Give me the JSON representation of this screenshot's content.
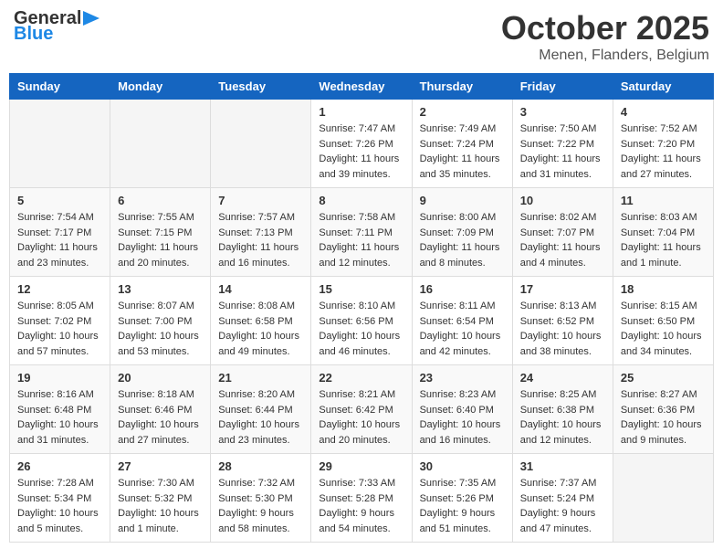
{
  "header": {
    "logo_general": "General",
    "logo_blue": "Blue",
    "month_title": "October 2025",
    "location": "Menen, Flanders, Belgium"
  },
  "days_of_week": [
    "Sunday",
    "Monday",
    "Tuesday",
    "Wednesday",
    "Thursday",
    "Friday",
    "Saturday"
  ],
  "weeks": [
    [
      {
        "day": "",
        "info": ""
      },
      {
        "day": "",
        "info": ""
      },
      {
        "day": "",
        "info": ""
      },
      {
        "day": "1",
        "info": "Sunrise: 7:47 AM\nSunset: 7:26 PM\nDaylight: 11 hours\nand 39 minutes."
      },
      {
        "day": "2",
        "info": "Sunrise: 7:49 AM\nSunset: 7:24 PM\nDaylight: 11 hours\nand 35 minutes."
      },
      {
        "day": "3",
        "info": "Sunrise: 7:50 AM\nSunset: 7:22 PM\nDaylight: 11 hours\nand 31 minutes."
      },
      {
        "day": "4",
        "info": "Sunrise: 7:52 AM\nSunset: 7:20 PM\nDaylight: 11 hours\nand 27 minutes."
      }
    ],
    [
      {
        "day": "5",
        "info": "Sunrise: 7:54 AM\nSunset: 7:17 PM\nDaylight: 11 hours\nand 23 minutes."
      },
      {
        "day": "6",
        "info": "Sunrise: 7:55 AM\nSunset: 7:15 PM\nDaylight: 11 hours\nand 20 minutes."
      },
      {
        "day": "7",
        "info": "Sunrise: 7:57 AM\nSunset: 7:13 PM\nDaylight: 11 hours\nand 16 minutes."
      },
      {
        "day": "8",
        "info": "Sunrise: 7:58 AM\nSunset: 7:11 PM\nDaylight: 11 hours\nand 12 minutes."
      },
      {
        "day": "9",
        "info": "Sunrise: 8:00 AM\nSunset: 7:09 PM\nDaylight: 11 hours\nand 8 minutes."
      },
      {
        "day": "10",
        "info": "Sunrise: 8:02 AM\nSunset: 7:07 PM\nDaylight: 11 hours\nand 4 minutes."
      },
      {
        "day": "11",
        "info": "Sunrise: 8:03 AM\nSunset: 7:04 PM\nDaylight: 11 hours\nand 1 minute."
      }
    ],
    [
      {
        "day": "12",
        "info": "Sunrise: 8:05 AM\nSunset: 7:02 PM\nDaylight: 10 hours\nand 57 minutes."
      },
      {
        "day": "13",
        "info": "Sunrise: 8:07 AM\nSunset: 7:00 PM\nDaylight: 10 hours\nand 53 minutes."
      },
      {
        "day": "14",
        "info": "Sunrise: 8:08 AM\nSunset: 6:58 PM\nDaylight: 10 hours\nand 49 minutes."
      },
      {
        "day": "15",
        "info": "Sunrise: 8:10 AM\nSunset: 6:56 PM\nDaylight: 10 hours\nand 46 minutes."
      },
      {
        "day": "16",
        "info": "Sunrise: 8:11 AM\nSunset: 6:54 PM\nDaylight: 10 hours\nand 42 minutes."
      },
      {
        "day": "17",
        "info": "Sunrise: 8:13 AM\nSunset: 6:52 PM\nDaylight: 10 hours\nand 38 minutes."
      },
      {
        "day": "18",
        "info": "Sunrise: 8:15 AM\nSunset: 6:50 PM\nDaylight: 10 hours\nand 34 minutes."
      }
    ],
    [
      {
        "day": "19",
        "info": "Sunrise: 8:16 AM\nSunset: 6:48 PM\nDaylight: 10 hours\nand 31 minutes."
      },
      {
        "day": "20",
        "info": "Sunrise: 8:18 AM\nSunset: 6:46 PM\nDaylight: 10 hours\nand 27 minutes."
      },
      {
        "day": "21",
        "info": "Sunrise: 8:20 AM\nSunset: 6:44 PM\nDaylight: 10 hours\nand 23 minutes."
      },
      {
        "day": "22",
        "info": "Sunrise: 8:21 AM\nSunset: 6:42 PM\nDaylight: 10 hours\nand 20 minutes."
      },
      {
        "day": "23",
        "info": "Sunrise: 8:23 AM\nSunset: 6:40 PM\nDaylight: 10 hours\nand 16 minutes."
      },
      {
        "day": "24",
        "info": "Sunrise: 8:25 AM\nSunset: 6:38 PM\nDaylight: 10 hours\nand 12 minutes."
      },
      {
        "day": "25",
        "info": "Sunrise: 8:27 AM\nSunset: 6:36 PM\nDaylight: 10 hours\nand 9 minutes."
      }
    ],
    [
      {
        "day": "26",
        "info": "Sunrise: 7:28 AM\nSunset: 5:34 PM\nDaylight: 10 hours\nand 5 minutes."
      },
      {
        "day": "27",
        "info": "Sunrise: 7:30 AM\nSunset: 5:32 PM\nDaylight: 10 hours\nand 1 minute."
      },
      {
        "day": "28",
        "info": "Sunrise: 7:32 AM\nSunset: 5:30 PM\nDaylight: 9 hours\nand 58 minutes."
      },
      {
        "day": "29",
        "info": "Sunrise: 7:33 AM\nSunset: 5:28 PM\nDaylight: 9 hours\nand 54 minutes."
      },
      {
        "day": "30",
        "info": "Sunrise: 7:35 AM\nSunset: 5:26 PM\nDaylight: 9 hours\nand 51 minutes."
      },
      {
        "day": "31",
        "info": "Sunrise: 7:37 AM\nSunset: 5:24 PM\nDaylight: 9 hours\nand 47 minutes."
      },
      {
        "day": "",
        "info": ""
      }
    ]
  ]
}
